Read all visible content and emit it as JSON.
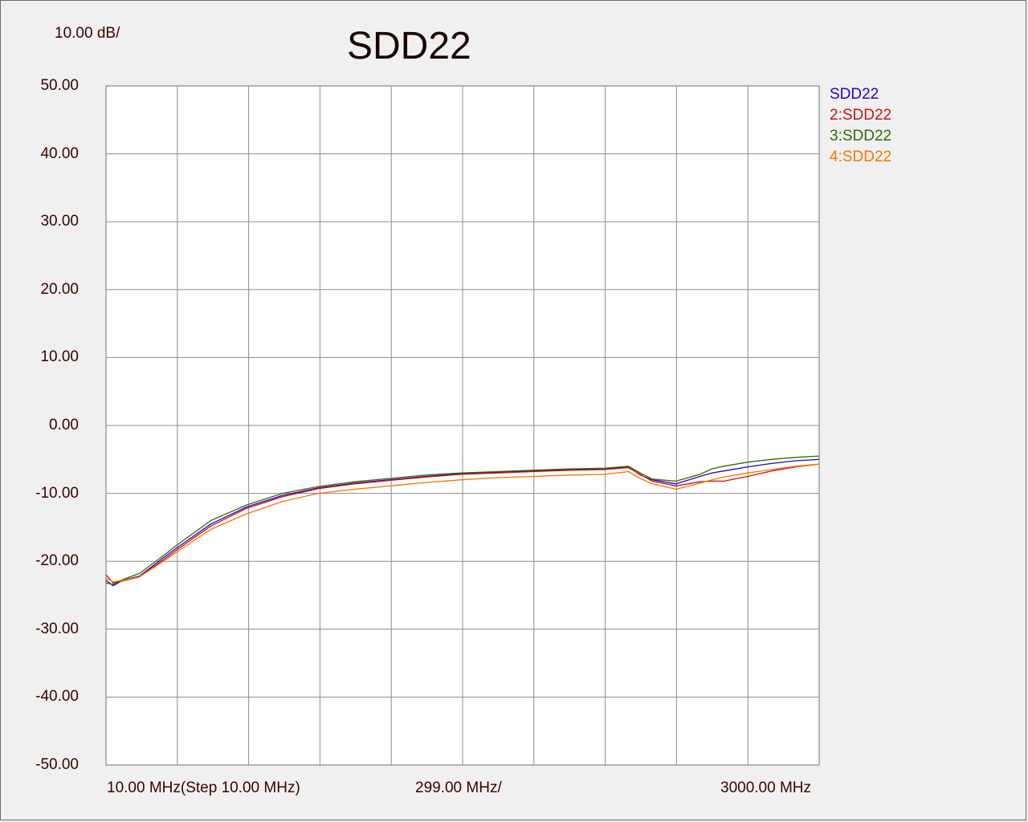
{
  "chart_data": {
    "type": "line",
    "title": "SDD22",
    "scale_label": "10.00 dB/",
    "x_tick_labels": [
      "10.00 MHz(Step 10.00 MHz)",
      "299.00 MHz/",
      "3000.00 MHz"
    ],
    "xlim": [
      10,
      3000
    ],
    "ylim": [
      -50,
      50
    ],
    "y_ticks": [
      "50.00",
      "40.00",
      "30.00",
      "20.00",
      "10.00",
      "0.00",
      "-10.00",
      "-20.00",
      "-30.00",
      "-40.00",
      "-50.00"
    ],
    "grid": true,
    "legend_placement": "top-right outside plot",
    "x": [
      10,
      40,
      80,
      150,
      250,
      300,
      450,
      600,
      750,
      900,
      1050,
      1200,
      1350,
      1500,
      1650,
      1800,
      1950,
      2100,
      2200,
      2250,
      2300,
      2400,
      2500,
      2550,
      2600,
      2700,
      2800,
      2900,
      3000
    ],
    "series": [
      {
        "name": "SDD22",
        "color": "#2b00c8",
        "values": [
          -22.8,
          -23.6,
          -22.8,
          -22.2,
          -19.5,
          -18.2,
          -14.5,
          -12.0,
          -10.3,
          -9.2,
          -8.5,
          -8.0,
          -7.5,
          -7.1,
          -6.9,
          -6.7,
          -6.5,
          -6.4,
          -6.1,
          -7.3,
          -8.0,
          -8.6,
          -7.5,
          -7.0,
          -6.7,
          -6.1,
          -5.6,
          -5.2,
          -5.0
        ]
      },
      {
        "name": "2:SDD22",
        "color": "#d01010",
        "values": [
          -22.0,
          -23.2,
          -22.9,
          -22.3,
          -19.8,
          -18.5,
          -14.8,
          -12.2,
          -10.5,
          -9.3,
          -8.6,
          -8.1,
          -7.6,
          -7.2,
          -7.0,
          -6.8,
          -6.6,
          -6.5,
          -6.2,
          -7.2,
          -8.2,
          -8.9,
          -8.3,
          -8.2,
          -8.2,
          -7.5,
          -6.7,
          -6.1,
          -5.7
        ]
      },
      {
        "name": "3:SDD22",
        "color": "#2e6e00",
        "values": [
          -23.2,
          -23.4,
          -22.7,
          -21.8,
          -19.2,
          -17.8,
          -14.0,
          -11.7,
          -10.0,
          -9.0,
          -8.3,
          -7.8,
          -7.3,
          -7.0,
          -6.8,
          -6.6,
          -6.4,
          -6.3,
          -6.0,
          -7.0,
          -7.9,
          -8.2,
          -7.2,
          -6.4,
          -6.0,
          -5.4,
          -5.0,
          -4.7,
          -4.5
        ]
      },
      {
        "name": "4:SDD22",
        "color": "#f07800",
        "values": [
          -22.5,
          -23.0,
          -22.8,
          -22.3,
          -20.0,
          -18.8,
          -15.3,
          -13.0,
          -11.2,
          -10.0,
          -9.4,
          -8.9,
          -8.4,
          -8.0,
          -7.7,
          -7.5,
          -7.3,
          -7.2,
          -6.8,
          -7.8,
          -8.6,
          -9.4,
          -8.5,
          -8.0,
          -7.6,
          -7.0,
          -6.5,
          -6.0,
          -5.7
        ]
      }
    ]
  }
}
